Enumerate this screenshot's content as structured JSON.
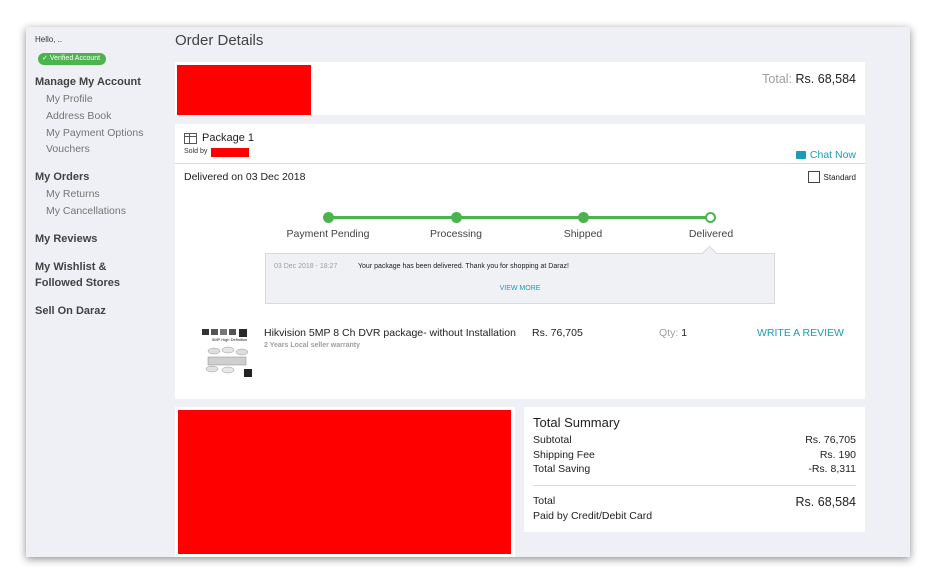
{
  "sidebar": {
    "hello": "Hello, ..",
    "verified": "Verified Account",
    "manage": {
      "heading": "Manage My Account",
      "items": [
        "My Profile",
        "Address Book",
        "My Payment Options",
        "Vouchers"
      ]
    },
    "orders": {
      "heading": "My Orders",
      "items": [
        "My Returns",
        "My Cancellations"
      ]
    },
    "reviews": "My Reviews",
    "wishlist_line1": "My Wishlist &",
    "wishlist_line2": "Followed Stores",
    "sell": "Sell On Daraz"
  },
  "page_title": "Order Details",
  "order_header": {
    "total_label": "Total:",
    "total_value": "Rs. 68,584"
  },
  "package": {
    "title": "Package 1",
    "sold_by": "Sold by",
    "chat": "Chat Now",
    "delivered_on": "Delivered on 03 Dec 2018",
    "shipping_type": "Standard",
    "steps": [
      "Payment Pending",
      "Processing",
      "Shipped",
      "Delivered"
    ],
    "status_date": "03 Dec 2018 - 18:27",
    "status_msg": "Your package has been delivered. Thank you for shopping at Daraz!",
    "view_more": "VIEW MORE",
    "item": {
      "name": "Hikvision 5MP 8 Ch DVR package- without Installation",
      "warranty": "2 Years Local seller warranty",
      "price": "Rs. 76,705",
      "qty_label": "Qty:",
      "qty": "1",
      "review": "WRITE A REVIEW",
      "thumb_caption": "5MP High Definition"
    }
  },
  "summary": {
    "title": "Total Summary",
    "subtotal_label": "Subtotal",
    "subtotal": "Rs. 76,705",
    "shipping_label": "Shipping Fee",
    "shipping": "Rs. 190",
    "saving_label": "Total Saving",
    "saving": "-Rs. 8,311",
    "total_label": "Total",
    "total": "Rs. 68,584",
    "paid_by": "Paid by Credit/Debit Card"
  },
  "colors": {
    "accent_green": "#4cb44c",
    "link_blue": "#1a9cb7",
    "redaction": "#ff0000",
    "background": "#eff0f5"
  }
}
